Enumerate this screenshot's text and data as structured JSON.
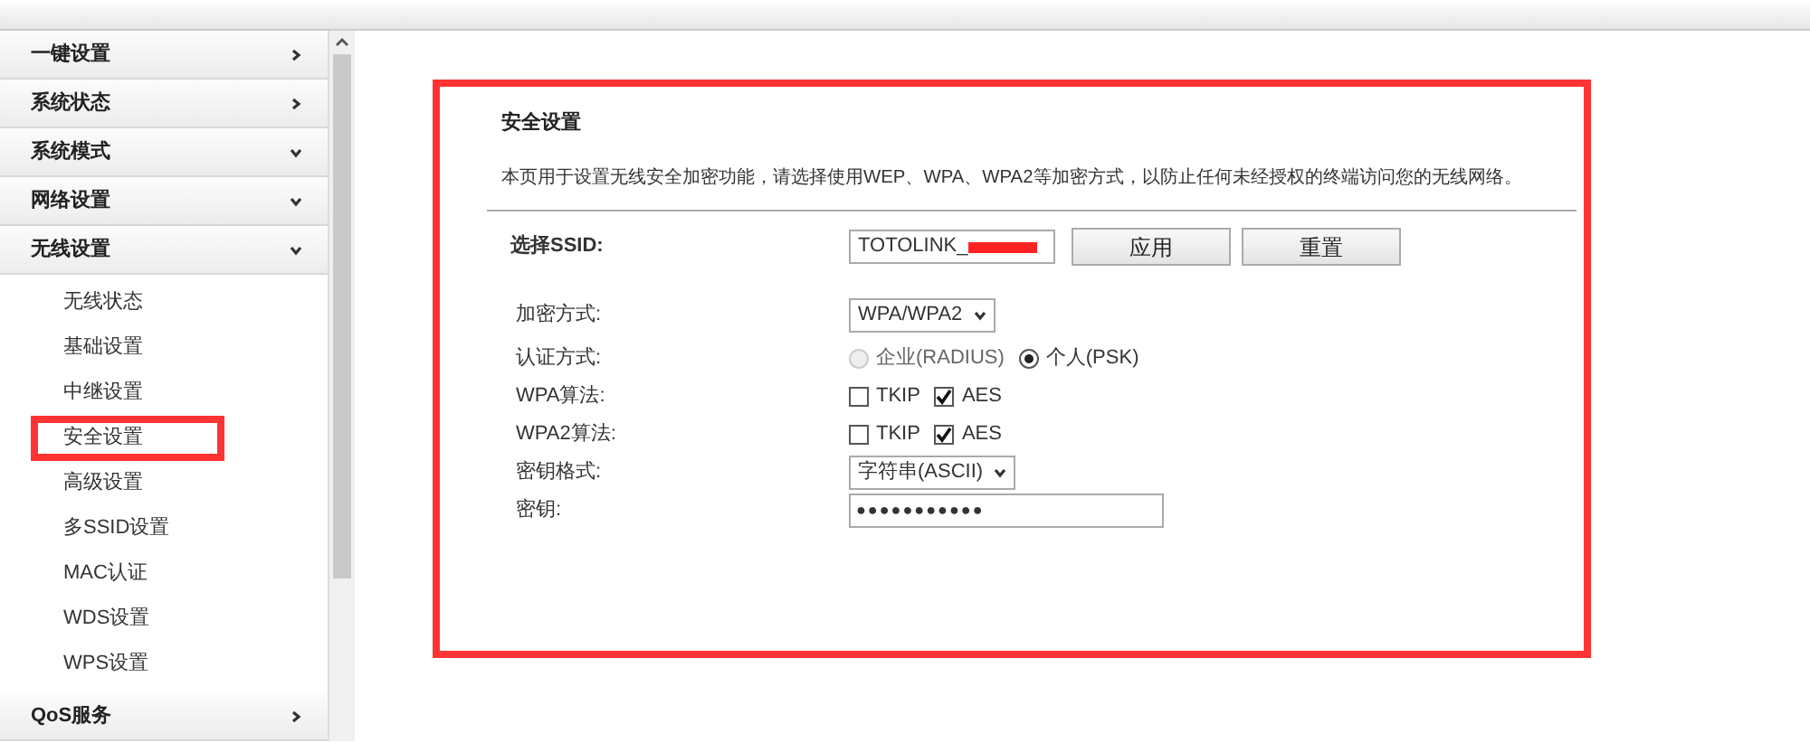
{
  "sidebar": {
    "items": [
      {
        "label": "一键设置",
        "expanded": false
      },
      {
        "label": "系统状态",
        "expanded": false
      },
      {
        "label": "系统模式",
        "expanded": true
      },
      {
        "label": "网络设置",
        "expanded": true
      },
      {
        "label": "无线设置",
        "expanded": true,
        "children": [
          {
            "label": "无线状态",
            "highlighted": false
          },
          {
            "label": "基础设置",
            "highlighted": false
          },
          {
            "label": "中继设置",
            "highlighted": false
          },
          {
            "label": "安全设置",
            "highlighted": true
          },
          {
            "label": "高级设置",
            "highlighted": false
          },
          {
            "label": "多SSID设置",
            "highlighted": false
          },
          {
            "label": "MAC认证",
            "highlighted": false
          },
          {
            "label": "WDS设置",
            "highlighted": false
          },
          {
            "label": "WPS设置",
            "highlighted": false
          }
        ]
      },
      {
        "label": "QoS服务",
        "expanded": false
      }
    ]
  },
  "content": {
    "highlighted": true,
    "title": "安全设置",
    "description": "本页用于设置无线安全加密功能，请选择使用WEP、WPA、WPA2等加密方式，以防止任何未经授权的终端访问您的无线网络。",
    "ssid": {
      "label": "选择SSID:",
      "value": "TOTOLINK_",
      "redacted": true
    },
    "buttons": [
      "应用",
      "重置"
    ],
    "fields": [
      {
        "kind": "select",
        "label": "加密方式:",
        "value": "WPA/WPA2"
      },
      {
        "kind": "radio",
        "label": "认证方式:",
        "options": [
          {
            "label": "企业(RADIUS)",
            "selected": false,
            "disabled": true
          },
          {
            "label": "个人(PSK)",
            "selected": true,
            "disabled": false
          }
        ]
      },
      {
        "kind": "checkbox",
        "label": "WPA算法:",
        "options": [
          {
            "label": "TKIP",
            "checked": false
          },
          {
            "label": "AES",
            "checked": true
          }
        ]
      },
      {
        "kind": "checkbox",
        "label": "WPA2算法:",
        "options": [
          {
            "label": "TKIP",
            "checked": false
          },
          {
            "label": "AES",
            "checked": true
          }
        ]
      },
      {
        "kind": "select",
        "label": "密钥格式:",
        "value": "字符串(ASCII)"
      },
      {
        "kind": "password",
        "label": "密钥:",
        "value": "●●●●●●●●●●●"
      }
    ]
  }
}
